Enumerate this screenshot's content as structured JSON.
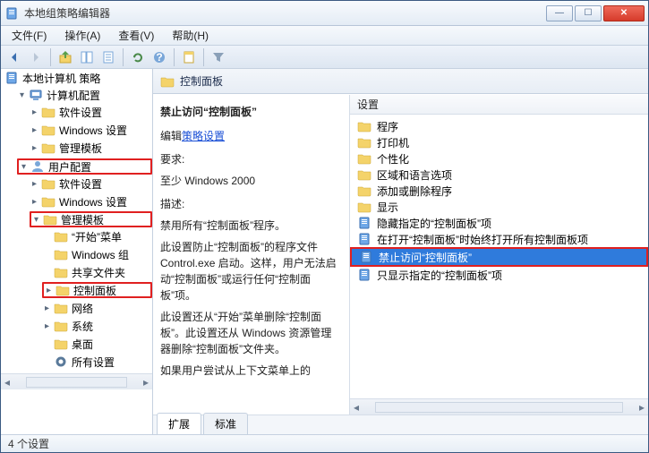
{
  "window": {
    "title": "本地组策略编辑器"
  },
  "menu": {
    "file": "文件(F)",
    "action": "操作(A)",
    "view": "查看(V)",
    "help": "帮助(H)"
  },
  "tree": {
    "root": "本地计算机 策略",
    "computer": "计算机配置",
    "c_soft": "软件设置",
    "c_win": "Windows 设置",
    "c_admin": "管理模板",
    "user": "用户配置",
    "u_soft": "软件设置",
    "u_win": "Windows 设置",
    "u_admin": "管理模板",
    "start": "“开始”菜单",
    "wincomp": "Windows 组",
    "shared": "共享文件夹",
    "cpanel": "控制面板",
    "network": "网络",
    "system": "系统",
    "desktop": "桌面",
    "allset": "所有设置"
  },
  "header": {
    "title": "控制面板"
  },
  "desc": {
    "title": "禁止访问“控制面板”",
    "edit_prefix": "编辑",
    "edit_link": "策略设置",
    "req_label": "要求:",
    "req_text": "至少 Windows 2000",
    "desc_label": "描述:",
    "p1": "禁用所有“控制面板”程序。",
    "p2": "此设置防止“控制面板”的程序文件 Control.exe 启动。这样，用户无法启动“控制面板”或运行任何“控制面板”项。",
    "p3": "此设置还从“开始”菜单删除“控制面板”。此设置还从 Windows 资源管理器删除“控制面板”文件夹。",
    "p4": "如果用户尝试从上下文菜单上的"
  },
  "list": {
    "header": "设置",
    "items": [
      "程序",
      "打印机",
      "个性化",
      "区域和语言选项",
      "添加或删除程序",
      "显示",
      "隐藏指定的“控制面板”项",
      "在打开“控制面板”时始终打开所有控制面板项",
      "禁止访问“控制面板”",
      "只显示指定的“控制面板”项"
    ],
    "selected_index": 8,
    "folder_count": 6
  },
  "tabs": {
    "extended": "扩展",
    "standard": "标准"
  },
  "status": {
    "text": "4 个设置"
  }
}
